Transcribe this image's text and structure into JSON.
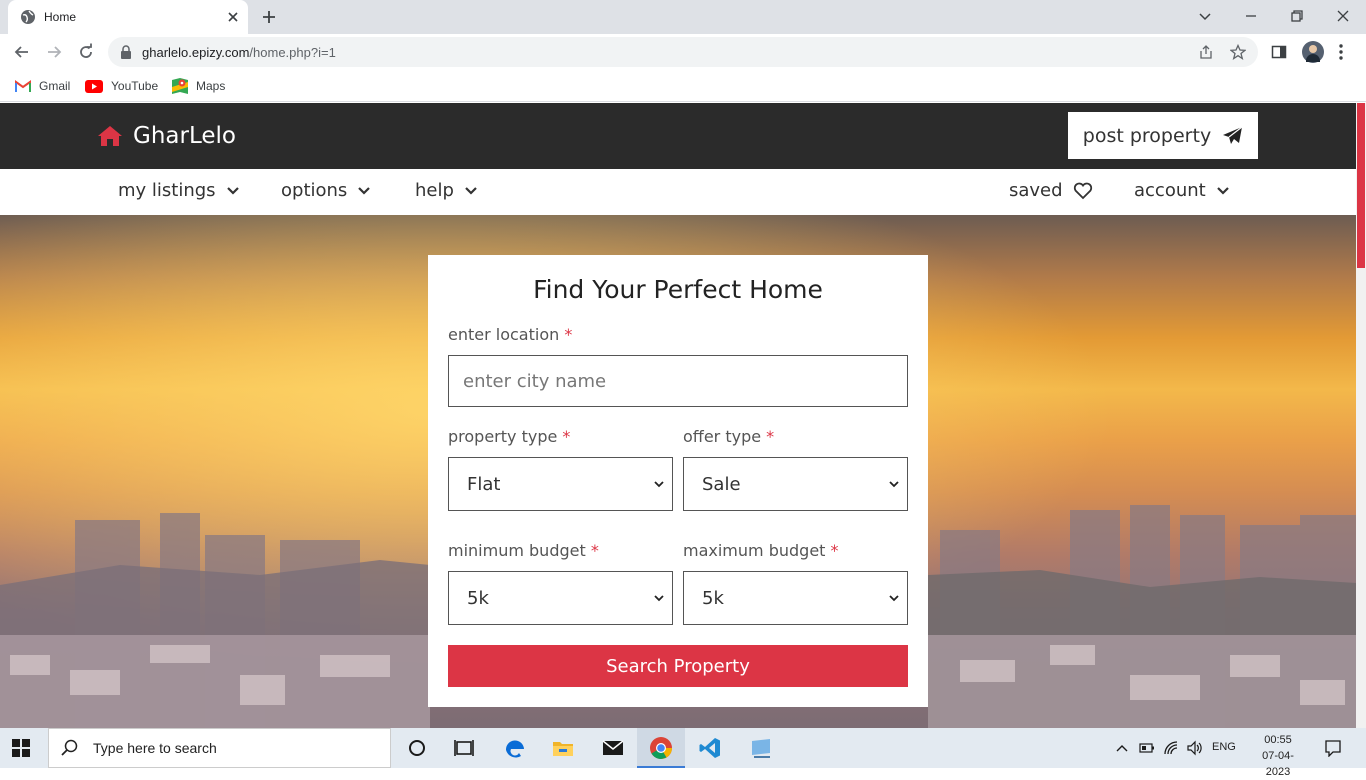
{
  "browser": {
    "tab_title": "Home",
    "url_host": "gharlelo.epizy.com",
    "url_path": "/home.php?i=1",
    "bookmarks": [
      {
        "label": "Gmail",
        "icon": "gmail-icon"
      },
      {
        "label": "YouTube",
        "icon": "youtube-icon"
      },
      {
        "label": "Maps",
        "icon": "maps-icon"
      }
    ]
  },
  "site": {
    "brand": "GharLelo",
    "brand_color": "#dc3545",
    "post_property_label": "post property",
    "nav": {
      "my_listings": "my listings",
      "options": "options",
      "help": "help",
      "saved": "saved",
      "account": "account"
    }
  },
  "search_form": {
    "title": "Find Your Perfect Home",
    "location_label": "enter location",
    "location_placeholder": "enter city name",
    "required_marker": "*",
    "property_type_label": "property type",
    "property_type_value": "Flat",
    "offer_type_label": "offer type",
    "offer_type_value": "Sale",
    "min_budget_label": "minimum budget",
    "min_budget_value": "5k",
    "max_budget_label": "maximum budget",
    "max_budget_value": "5k",
    "submit_label": "Search Property"
  },
  "taskbar": {
    "search_placeholder": "Type here to search",
    "language": "ENG",
    "time": "00:55",
    "date": "07-04-2023"
  }
}
